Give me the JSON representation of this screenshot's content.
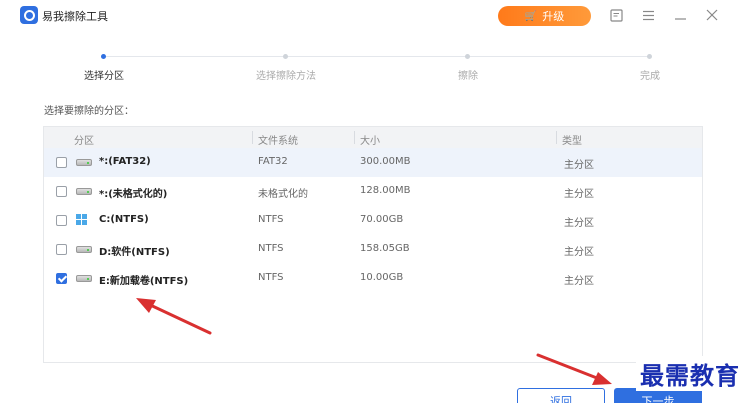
{
  "app": {
    "title": "易我擦除工具",
    "upgrade_label": "升级"
  },
  "window_icons": [
    "feedback-icon",
    "menu-icon",
    "minimize-icon",
    "close-icon"
  ],
  "steps": [
    {
      "label": "选择分区",
      "active": true
    },
    {
      "label": "选择擦除方法",
      "active": false
    },
    {
      "label": "擦除",
      "active": false
    },
    {
      "label": "完成",
      "active": false
    }
  ],
  "section_label": "选择要擦除的分区：",
  "table": {
    "headers": [
      "分区",
      "文件系统",
      "大小",
      "类型"
    ],
    "rows": [
      {
        "name": "*:(FAT32)",
        "fs": "FAT32",
        "size": "300.00MB",
        "type": "主分区",
        "checked": false,
        "icon": "drive-icon"
      },
      {
        "name": "*:(未格式化的)",
        "fs": "未格式化的",
        "size": "128.00MB",
        "type": "主分区",
        "checked": false,
        "icon": "drive-icon"
      },
      {
        "name": "C:(NTFS)",
        "fs": "NTFS",
        "size": "70.00GB",
        "type": "主分区",
        "checked": false,
        "icon": "windows-drive-icon"
      },
      {
        "name": "D:软件(NTFS)",
        "fs": "NTFS",
        "size": "158.05GB",
        "type": "主分区",
        "checked": false,
        "icon": "drive-icon"
      },
      {
        "name": "E:新加载卷(NTFS)",
        "fs": "NTFS",
        "size": "10.00GB",
        "type": "主分区",
        "checked": true,
        "icon": "drive-icon"
      }
    ]
  },
  "buttons": {
    "back": "返回",
    "next": "下一步"
  },
  "watermark": "最需教育",
  "colors": {
    "accent": "#2f6fe0",
    "upgrade": "#ff8a2a",
    "arrow": "#d93030"
  }
}
